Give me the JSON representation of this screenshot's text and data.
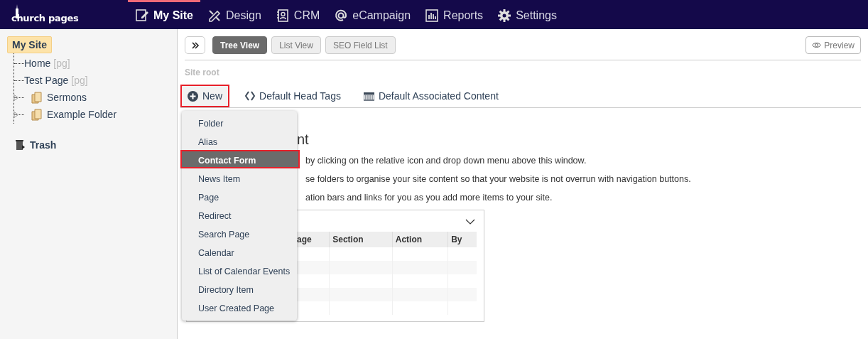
{
  "brand": {
    "name": "church pages"
  },
  "nav_tabs": [
    {
      "label": "My Site",
      "selected": true
    },
    {
      "label": "Design",
      "selected": false
    },
    {
      "label": "CRM",
      "selected": false
    },
    {
      "label": "eCampaign",
      "selected": false
    },
    {
      "label": "Reports",
      "selected": false
    },
    {
      "label": "Settings",
      "selected": false
    }
  ],
  "sidebar": {
    "root": {
      "label": "My Site",
      "selected": true
    },
    "items": [
      {
        "kind": "page",
        "label": "Home",
        "suffix": "[pg]",
        "selected": false
      },
      {
        "kind": "page",
        "label": "Test Page",
        "suffix": "[pg]",
        "selected": false
      },
      {
        "kind": "folder",
        "label": "Sermons",
        "expanded": false,
        "selected": false
      },
      {
        "kind": "folder",
        "label": "Example Folder",
        "expanded": false,
        "selected": false
      }
    ],
    "trash": {
      "label": "Trash"
    }
  },
  "view_tabs": [
    {
      "label": "Tree View",
      "selected": true
    },
    {
      "label": "List View",
      "selected": false
    },
    {
      "label": "SEO Field List",
      "selected": false
    }
  ],
  "preview_button": {
    "label": "Preview"
  },
  "breadcrumb": "Site root",
  "actions": [
    {
      "kind": "new",
      "label": "New",
      "highlighted": true
    },
    {
      "kind": "head-tags",
      "label": "Default Head Tags",
      "highlighted": false
    },
    {
      "kind": "associated",
      "label": "Default Associated Content",
      "highlighted": false
    }
  ],
  "new_menu": {
    "items": [
      {
        "label": "Folder",
        "selected": false,
        "highlighted": false
      },
      {
        "label": "Alias",
        "selected": false,
        "highlighted": false
      },
      {
        "label": "Contact Form",
        "selected": true,
        "highlighted": true
      },
      {
        "label": "News Item",
        "selected": false,
        "highlighted": false
      },
      {
        "label": "Page",
        "selected": false,
        "highlighted": false
      },
      {
        "label": "Redirect",
        "selected": false,
        "highlighted": false
      },
      {
        "label": "Search Page",
        "selected": false,
        "highlighted": false
      },
      {
        "label": "Calendar",
        "selected": false,
        "highlighted": false
      },
      {
        "label": "List of Calendar Events",
        "selected": false,
        "highlighted": false
      },
      {
        "label": "Directory Item",
        "selected": false,
        "highlighted": false
      },
      {
        "label": "User Created Page",
        "selected": false,
        "highlighted": false
      }
    ]
  },
  "content": {
    "heading": "nt",
    "paragraphs": [
      "by clicking on the relative icon and drop down menu above this window.",
      "se folders to organise your site content so that your website is not overrun with navigation buttons.",
      "ation bars and links for you as you add more items to your site."
    ],
    "table": {
      "columns": [
        "age",
        "Section",
        "Action",
        "By"
      ]
    }
  }
}
